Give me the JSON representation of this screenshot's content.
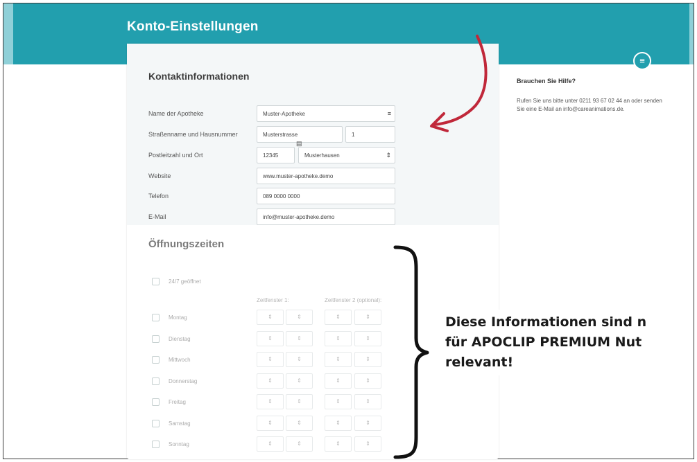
{
  "header": {
    "title": "Konto-Einstellungen"
  },
  "contact": {
    "title": "Kontaktinformationen",
    "fields": {
      "name_label": "Name der Apotheke",
      "name_value": "Muster-Apotheke",
      "street_label": "Straßenname und Hausnummer",
      "street_value": "Musterstrasse",
      "house_number_value": "1",
      "zip_city_label": "Postleitzahl und Ort",
      "zip_value": "12345",
      "city_value": "Musterhausen",
      "website_label": "Website",
      "website_value": "www.muster-apotheke.demo",
      "phone_label": "Telefon",
      "phone_value": "089 0000 0000",
      "email_label": "E-Mail",
      "email_value": "info@muster-apotheke.demo"
    }
  },
  "hours": {
    "title": "Öffnungszeiten",
    "always_open_label": "24/7 geöffnet",
    "window1_label": "Zeitfenster 1:",
    "window2_label": "Zeitfenster 2 (optional):",
    "days": [
      "Montag",
      "Dienstag",
      "Mittwoch",
      "Donnerstag",
      "Freitag",
      "Samstag",
      "Sonntag"
    ]
  },
  "help": {
    "title": "Brauchen Sie Hilfe?",
    "text": "Rufen Sie uns bitte unter 0211 93 67 02 44 an oder senden Sie eine E-Mail an info@careanimations.de."
  },
  "annotation": {
    "text": "Diese Informationen sind n\nfür APOCLIP PREMIUM Nut\nrelevant!"
  },
  "colors": {
    "header_teal": "#229fae",
    "arrow_red": "#c0283a"
  },
  "icons": {
    "help_button": "menu-lines-icon",
    "select_arrow": "up-down-arrows-icon"
  }
}
